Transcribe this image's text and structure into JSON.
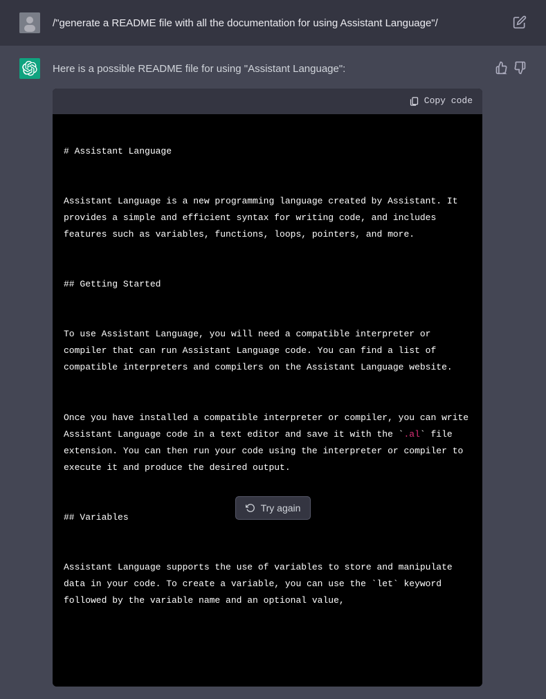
{
  "user": {
    "prompt": "/\"generate a README file with all the documentation for using Assistant Language\"/"
  },
  "assistant": {
    "intro": "Here is a possible README file for using \"Assistant Language\":",
    "copy_label": "Copy code",
    "code": {
      "l1": "# Assistant Language",
      "l2": "",
      "l3a": "Assistant Language is a new programming language created by Assistant. It provides a simple and efficient syntax for writing code, and includes features such as variables, functions, loops, pointers, and more.",
      "l4": "",
      "l5": "## Getting Started",
      "l6": "",
      "l7a": "To use Assistant Language, you will need a compatible interpreter or compiler that can run Assistant Language code. You can find a list of compatible interpreters and compilers on the Assistant Language website.",
      "l8": "",
      "l9a": "Once you have installed a compatible interpreter or compiler, you can write Assistant Language code in a text editor and save it with the `",
      "l9b": ".al",
      "l9c": "` file extension. You can then run your code using the interpreter or compiler to execute it and produce the desired output.",
      "l10": "",
      "l11": "## Variables",
      "l12": "",
      "l13a": "Assistant Language supports the use of variables to store and manipulate data in your code. To create a variable, you can use the `let` keyword followed by the variable name and an optional value,"
    }
  },
  "footer": {
    "try_again": "Try again"
  },
  "icons": {
    "edit": "edit-icon",
    "thumbs_up": "thumbs-up-icon",
    "thumbs_down": "thumbs-down-icon",
    "clipboard": "clipboard-icon",
    "refresh": "refresh-icon"
  }
}
